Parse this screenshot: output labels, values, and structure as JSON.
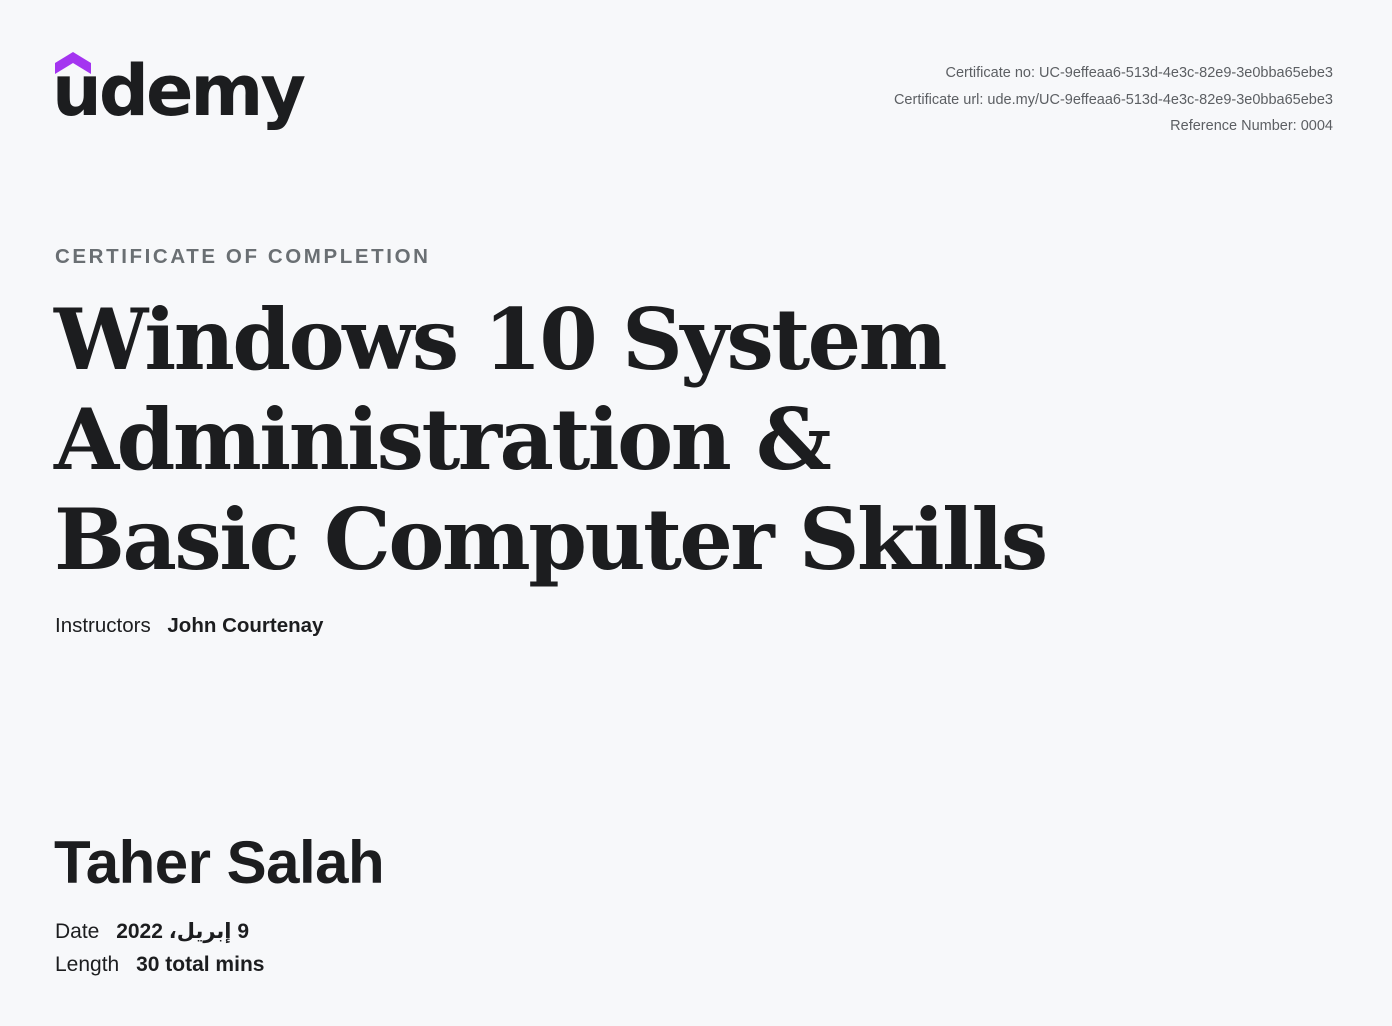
{
  "brand": {
    "name": "udemy",
    "accent_color": "#a435f0",
    "logo_icon": "udemy-hat-icon"
  },
  "certificate": {
    "number_line": "Certificate no: UC-9effeaa6-513d-4e3c-82e9-3e0bba65ebe3",
    "url_line": "Certificate url: ude.my/UC-9effeaa6-513d-4e3c-82e9-3e0bba65ebe3",
    "reference_line": "Reference Number: 0004"
  },
  "label": "CERTIFICATE OF COMPLETION",
  "course": {
    "title": "Windows 10 System Administration & Basic Computer Skills"
  },
  "instructors": {
    "label": "Instructors",
    "names": "John Courtenay"
  },
  "recipient": {
    "name": "Taher Salah"
  },
  "details": {
    "date_label": "Date",
    "date_value": "9 إبريل، 2022",
    "length_label": "Length",
    "length_value": "30 total mins"
  }
}
